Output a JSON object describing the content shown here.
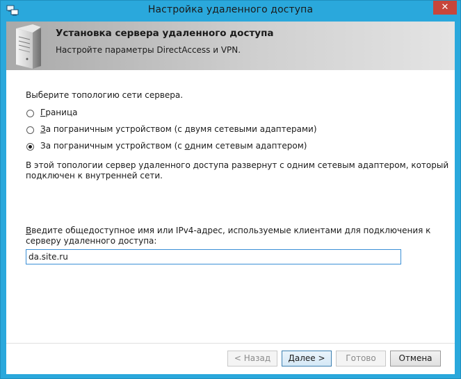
{
  "window": {
    "title": "Настройка удаленного доступа",
    "close_symbol": "✕",
    "accent_color": "#2aa8dc",
    "close_color": "#c7463b",
    "app_icon": "remote-access-icon"
  },
  "banner": {
    "title": "Установка сервера удаленного доступа",
    "subtitle": "Настройте параметры DirectAccess и VPN.",
    "icon": "server-icon"
  },
  "topology": {
    "prompt": "Выберите топологию сети сервера.",
    "options": [
      {
        "pre": "",
        "mnemonic": "Г",
        "post": "раница",
        "checked": false
      },
      {
        "pre": "",
        "mnemonic": "З",
        "post": "а пограничным устройством (с двумя сетевыми адаптерами)",
        "checked": false
      },
      {
        "pre": "За пограничным устройством (с ",
        "mnemonic": "о",
        "post": "дним сетевым адаптером)",
        "checked": true
      }
    ],
    "description_line1": "В этой топологии сервер удаленного доступа развернут с одним сетевым адаптером, который",
    "description_line2": "подключен к внутренней сети."
  },
  "address": {
    "label_mnemonic": "В",
    "label_line1_rest": "ведите общедоступное имя или IPv4-адрес, используемые клиентами для подключения к",
    "label_line2": "серверу удаленного доступа:",
    "value": "da.site.ru"
  },
  "buttons": {
    "back": {
      "label": "< Назад",
      "mnemonic": "Н",
      "enabled": false
    },
    "next": {
      "label": "Далее >",
      "mnemonic": "Д",
      "enabled": true
    },
    "finish": {
      "label": "Готово",
      "mnemonic": "Г",
      "enabled": false
    },
    "cancel": {
      "label": "Отмена",
      "enabled": true
    }
  }
}
